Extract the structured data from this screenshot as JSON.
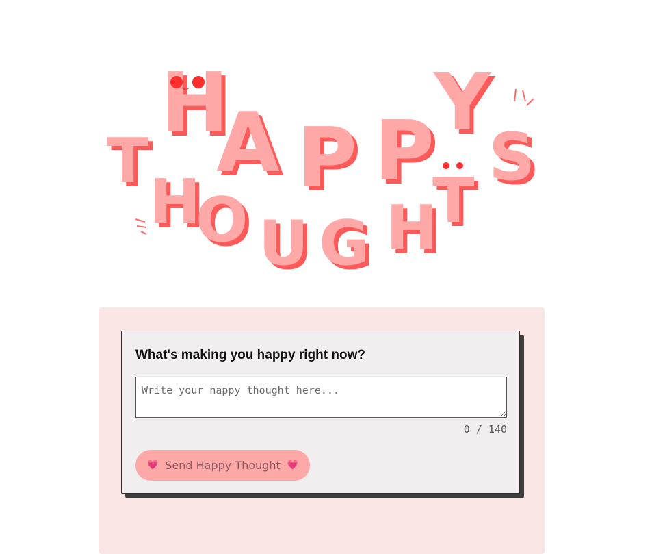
{
  "hero": {
    "logo_text": "HAPPY THOUGHTS",
    "letter_color": "#ffa8a8",
    "shadow_color": "#ff5a5a"
  },
  "form": {
    "question": "What's making you happy right now?",
    "input_placeholder": "Write your happy thought here...",
    "input_value": "",
    "counter": "0 / 140",
    "send_label": "Send Happy Thought",
    "heart_icon": "💗"
  },
  "colors": {
    "panel_bg": "#fae5e5",
    "card_bg": "#f0eeef",
    "button_bg": "#ffa8a8",
    "button_text": "#8a5a5f"
  }
}
